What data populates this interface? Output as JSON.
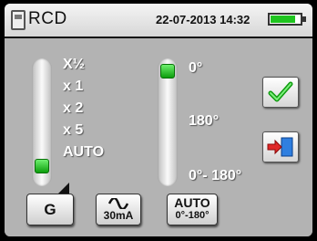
{
  "header": {
    "title": "RCD",
    "datetime": "22-07-2013 14:32",
    "battery_level": 0.85,
    "battery_color": "#1fc41f",
    "icon": "meter-icon"
  },
  "multiplier": {
    "options": [
      "X½",
      "x 1",
      "x 2",
      "x 5",
      "AUTO"
    ],
    "selected": "AUTO"
  },
  "phase": {
    "options": [
      "0°",
      "180°",
      "0°- 180°"
    ],
    "selected": "0°"
  },
  "side_buttons": [
    {
      "icon": "check-icon"
    },
    {
      "icon": "exit-icon"
    }
  ],
  "bottom_buttons": {
    "type": "G",
    "wave_label": "30mA",
    "auto_line1": "AUTO",
    "auto_line2": "0°-180°"
  },
  "colors": {
    "accent_green": "#1fc41f",
    "panel_bg": "#b3b3b3"
  }
}
